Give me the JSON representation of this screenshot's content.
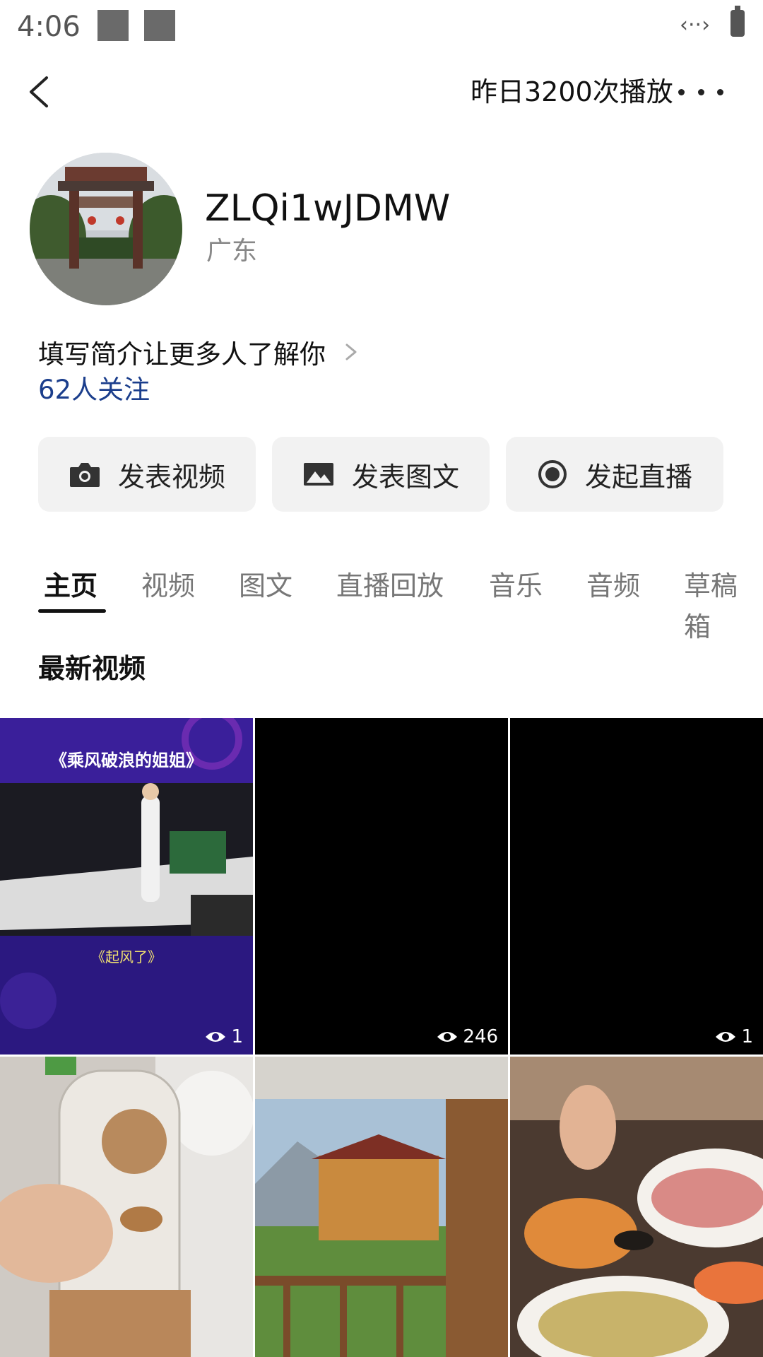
{
  "status_bar": {
    "time": "4:06"
  },
  "header": {
    "plays": "昨日3200次播放"
  },
  "profile": {
    "username": "ZLQi1wJDMW",
    "location": "广东",
    "bio_prompt": "填写简介让更多人了解你",
    "followers": "62人关注"
  },
  "actions": [
    {
      "label": "发表视频",
      "icon": "camera-icon"
    },
    {
      "label": "发表图文",
      "icon": "image-icon"
    },
    {
      "label": "发起直播",
      "icon": "live-record-icon"
    }
  ],
  "tabs": [
    "主页",
    "视频",
    "图文",
    "直播回放",
    "音乐",
    "音频",
    "草稿箱"
  ],
  "active_tab": "主页",
  "section_title": "最新视频",
  "videos": [
    {
      "title_top": "《乘风破浪的姐姐》",
      "title_bottom": "《起风了》",
      "views": "1"
    },
    {
      "views": "246"
    },
    {
      "views": "1"
    },
    {},
    {},
    {}
  ],
  "colors": {
    "link": "#1b3e8c",
    "button_bg": "#f2f2f2",
    "accent": "#111111"
  }
}
